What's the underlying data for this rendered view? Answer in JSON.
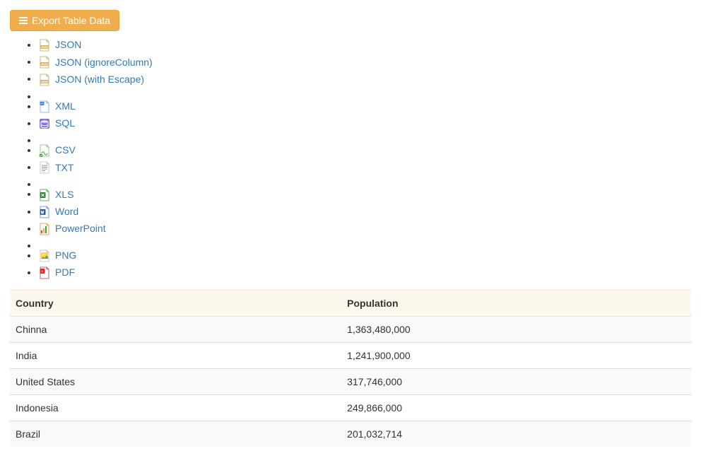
{
  "button": {
    "label": "Export Table Data"
  },
  "export_options": [
    {
      "type": "link",
      "icon": "json",
      "label": "JSON"
    },
    {
      "type": "link",
      "icon": "json",
      "label": "JSON (ignoreColumn)"
    },
    {
      "type": "link",
      "icon": "json",
      "label": "JSON (with Escape)"
    },
    {
      "type": "sep"
    },
    {
      "type": "link",
      "icon": "xml",
      "label": "XML"
    },
    {
      "type": "link",
      "icon": "sql",
      "label": "SQL"
    },
    {
      "type": "sep"
    },
    {
      "type": "link",
      "icon": "csv",
      "label": "CSV"
    },
    {
      "type": "link",
      "icon": "txt",
      "label": "TXT"
    },
    {
      "type": "sep"
    },
    {
      "type": "link",
      "icon": "xls",
      "label": "XLS"
    },
    {
      "type": "link",
      "icon": "word",
      "label": "Word"
    },
    {
      "type": "link",
      "icon": "ppt",
      "label": "PowerPoint"
    },
    {
      "type": "sep"
    },
    {
      "type": "link",
      "icon": "png",
      "label": "PNG"
    },
    {
      "type": "link",
      "icon": "pdf",
      "label": "PDF"
    }
  ],
  "table": {
    "headers": [
      "Country",
      "Population"
    ],
    "rows": [
      [
        "Chinna",
        "1,363,480,000"
      ],
      [
        "India",
        "1,241,900,000"
      ],
      [
        "United States",
        "317,746,000"
      ],
      [
        "Indonesia",
        "249,866,000"
      ],
      [
        "Brazil",
        "201,032,714"
      ]
    ]
  },
  "icon_svgs": {
    "json": "<svg viewBox='0 0 18 18'><path d='M3 1h9l3 3v13H3z' fill='#fff' stroke='#c0a060' stroke-width='0.8'/><path d='M12 1v3h3' fill='none' stroke='#c0a060' stroke-width='0.8'/><rect x='3' y='9' width='12' height='5' rx='1' fill='#d6b46a'/><text x='9' y='12.8' font-size='3.6' font-family='Arial' font-weight='bold' fill='#fff' text-anchor='middle'>JSON</text></svg>",
    "xml": "<svg viewBox='0 0 18 18'><path d='M3 1h9l3 3v13H3z' fill='#fff' stroke='#7aa3d6' stroke-width='0.8'/><path d='M12 1v3h3' fill='none' stroke='#7aa3d6' stroke-width='0.8'/><rect x='2.5' y='2' width='6' height='5' rx='1' fill='#3b82d6'/><text x='5.5' y='5.6' font-size='3' font-family='Arial' font-weight='bold' fill='#fff' text-anchor='middle'>&lt;/&gt;</text></svg>",
    "sql": "<svg viewBox='0 0 18 18'><rect x='2' y='2' width='14' height='14' rx='2' fill='#8d6fe0'/><ellipse cx='9' cy='6' rx='5' ry='1.8' fill='#fff' opacity='0.85'/><path d='M4 6v4c0 1 2.2 1.8 5 1.8s5-.8 5-1.8V6' fill='none' stroke='#fff' stroke-width='1'/><path d='M4 10v3c0 1 2.2 1.8 5 1.8s5-.8 5-1.8v-3' fill='none' stroke='#fff' stroke-width='1'/></svg>",
    "csv": "<svg viewBox='0 0 18 18'><path d='M3 1h9l3 3v13H3z' fill='#fff' stroke='#6fbf6f' stroke-width='0.8'/><path d='M12 1v3h3' fill='none' stroke='#6fbf6f' stroke-width='0.8'/><path d='M5 13c1-3 3-3 4 0s3 3 4 0' fill='none' stroke='#3aa33a' stroke-width='1'/><circle cx='4' cy='16' r='2.4' fill='#3aa33a'/><path d='M3 16l.8.8L5 15.2' fill='none' stroke='#fff' stroke-width='0.8'/></svg>",
    "txt": "<svg viewBox='0 0 18 18'><path d='M3 1h9l3 3v13H3z' fill='#fff' stroke='#bbb' stroke-width='0.8'/><path d='M12 1v3h3' fill='none' stroke='#bbb' stroke-width='0.8'/><line x1='5' y1='6'  x2='13' y2='6'  stroke='#888' stroke-width='0.9'/><line x1='5' y1='8.5' x2='13' y2='8.5' stroke='#888' stroke-width='0.9'/><line x1='5' y1='11' x2='13' y2='11' stroke='#888' stroke-width='0.9'/><line x1='5' y1='13.5' x2='10' y2='13.5' stroke='#888' stroke-width='0.9'/></svg>",
    "xls": "<svg viewBox='0 0 18 18'><path d='M3 1h9l3 3v13H3z' fill='#fff' stroke='#3a9a3a' stroke-width='0.8'/><path d='M12 1v3h3' fill='none' stroke='#3a9a3a' stroke-width='0.8'/><rect x='2.5' y='5' width='8' height='8' rx='1' fill='#2e7d32'/><path d='M4.5 7l4 4M8.5 7l-4 4' stroke='#fff' stroke-width='1.2'/></svg>",
    "word": "<svg viewBox='0 0 18 18'><path d='M3 1h9l3 3v13H3z' fill='#fff' stroke='#4a7fd6' stroke-width='0.8'/><path d='M12 1v3h3' fill='none' stroke='#4a7fd6' stroke-width='0.8'/><rect x='2.5' y='5' width='8' height='8' rx='1' fill='#2b579a'/><path d='M4 7l1 4 1-3 1 3 1-4' fill='none' stroke='#fff' stroke-width='1'/></svg>",
    "ppt": "<svg viewBox='0 0 18 18'><path d='M3 1h9l3 3v13H3z' fill='#fff' stroke='#e48a3c' stroke-width='0.8'/><path d='M12 1v3h3' fill='none' stroke='#e48a3c' stroke-width='0.8'/><rect x='4' y='11' width='2' height='4' fill='#d24726'/><rect x='7' y='8' width='2' height='7' fill='#f0ad4e'/><rect x='10' y='5' width='2' height='10' fill='#3aa33a'/></svg>",
    "png": "<svg viewBox='0 0 18 18'><path d='M3 1h9l3 3v13H3z' fill='#fff' stroke='#bbb' stroke-width='0.8'/><path d='M12 1v3h3' fill='none' stroke='#bbb' stroke-width='0.8'/><rect x='4' y='4' width='10' height='9' rx='1' fill='#ffd54f'/><circle cx='7' cy='7' r='1.3' fill='#fff176'/><path d='M4 13l3-3 2 2 3-4 2 3v2H4z' fill='#4caf50'/></svg>",
    "pdf": "<svg viewBox='0 0 18 18'><path d='M3 1h9l3 3v13H3z' fill='#fff' stroke='#c33' stroke-width='0.8'/><path d='M12 1v3h3' fill='none' stroke='#c33' stroke-width='0.8'/><rect x='2.5' y='3' width='7' height='7' rx='1' fill='#d32f2f'/><path d='M6 4.5c-1 2 0 3 1 3.5c-1 .5-2 .2-2-1c0-1 .5-2 1-2.5z' fill='#fff'/></svg>"
  }
}
